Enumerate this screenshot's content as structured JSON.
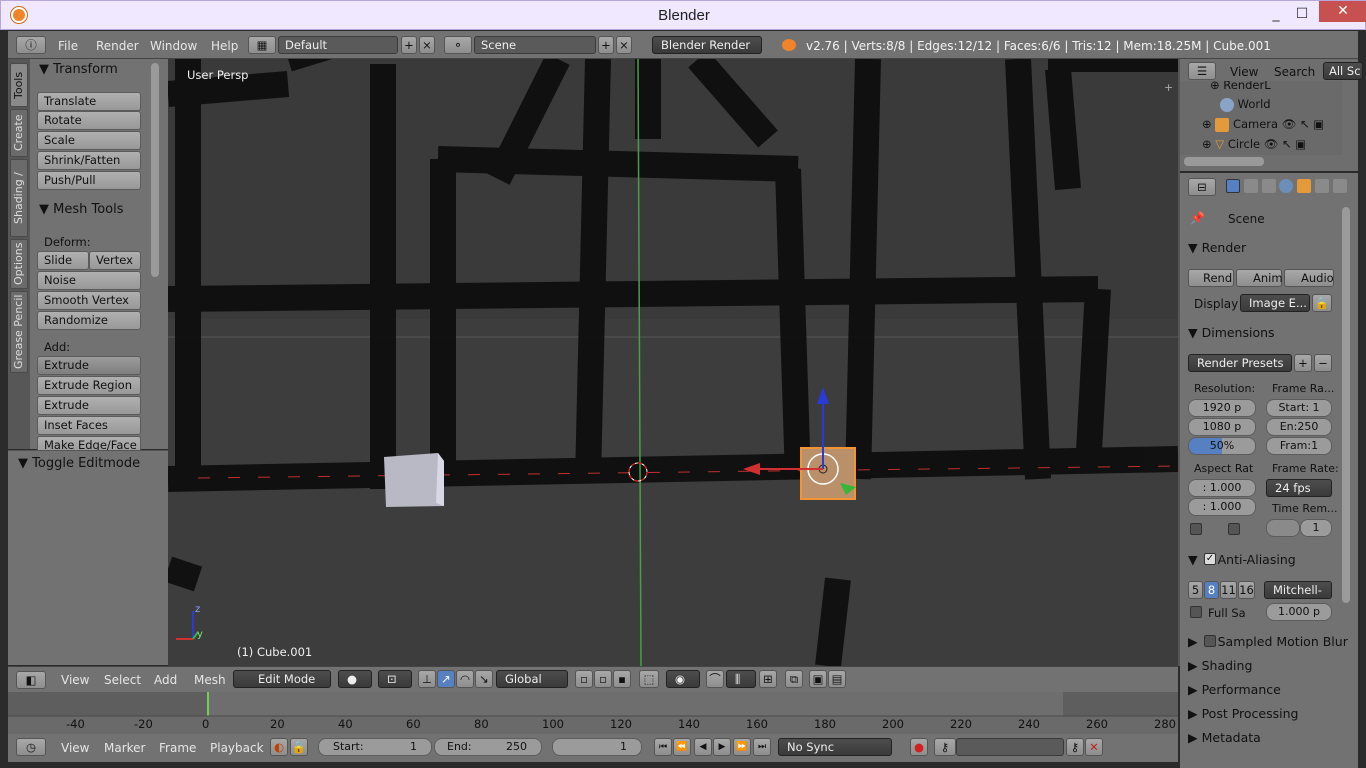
{
  "window": {
    "title": "Blender",
    "controls": [
      "_",
      "☐",
      "✕"
    ]
  },
  "info_header": {
    "menus": [
      "File",
      "Render",
      "Window",
      "Help"
    ],
    "screen": "Default",
    "scene": "Scene",
    "engine": "Blender Render",
    "stats": "v2.76 | Verts:8/8 | Edges:12/12 | Faces:6/6 | Tris:12 | Mem:18.25M | Cube.001"
  },
  "tool_tabs": [
    "Tools",
    "Create",
    "Shading / UVs",
    "Options",
    "Grease Pencil"
  ],
  "transform_panel": {
    "title": "Transform",
    "buttons": [
      "Translate",
      "Rotate",
      "Scale",
      "Shrink/Fatten",
      "Push/Pull"
    ]
  },
  "mesh_tools_panel": {
    "title": "Mesh Tools",
    "deform_label": "Deform:",
    "slide_edge": "Slide Ed",
    "vertex": "Vertex",
    "deform_buttons": [
      "Noise",
      "Smooth Vertex",
      "Randomize"
    ],
    "add_label": "Add:",
    "extrude": "Extrude",
    "add_buttons": [
      "Extrude Region",
      "Extrude Individual",
      "Inset Faces",
      "Make Edge/Face"
    ]
  },
  "toggle_editmode": "Toggle Editmode",
  "viewport": {
    "view_label": "User Persp",
    "object_label": "(1) Cube.001"
  },
  "view3d_header": {
    "menus": [
      "View",
      "Select",
      "Add",
      "Mesh"
    ],
    "mode": "Edit Mode",
    "orientation": "Global"
  },
  "timeline": {
    "ticks": [
      "-40",
      "-20",
      "0",
      "20",
      "40",
      "60",
      "80",
      "100",
      "120",
      "140",
      "160",
      "180",
      "200",
      "220",
      "240",
      "260",
      "280"
    ]
  },
  "timeline_header": {
    "menus": [
      "View",
      "Marker",
      "Frame",
      "Playback"
    ],
    "start_label": "Start:",
    "start_value": "1",
    "end_label": "End:",
    "end_value": "250",
    "current_frame": "1",
    "sync": "No Sync"
  },
  "outliner": {
    "menus": [
      "View",
      "Search"
    ],
    "filter": "All Sc",
    "items": [
      "RenderL",
      "World",
      "Camera",
      "Circle"
    ]
  },
  "properties": {
    "context": "Scene",
    "render": {
      "title": "Render",
      "buttons": [
        "Rend",
        "Anim",
        "Audio"
      ],
      "display_label": "Display",
      "display_value": "Image E..."
    },
    "dimensions": {
      "title": "Dimensions",
      "presets": "Render Presets",
      "resolution_label": "Resolution:",
      "res_x": "1920 p",
      "res_y": "1080 p",
      "res_pct": "50%",
      "frame_range_label": "Frame Ra...",
      "frame_start": "Start: 1",
      "frame_end": "En:250",
      "frame_step": "Fram:1",
      "aspect_label": "Aspect Rat",
      "aspect_x": ": 1.000",
      "aspect_y": ": 1.000",
      "frame_rate_label": "Frame Rate:",
      "fps": "24 fps",
      "time_remap_label": "Time Rem...",
      "time_remap_value": "1"
    },
    "anti_aliasing": {
      "title": "Anti-Aliasing",
      "samples": [
        "5",
        "8",
        "11",
        "16"
      ],
      "filter": "Mitchell-",
      "full_sample": "Full Sa",
      "size": "1.000 p"
    },
    "collapsed": [
      "Sampled Motion Blur",
      "Shading",
      "Performance",
      "Post Processing",
      "Metadata"
    ]
  },
  "colors": {
    "accent": "#5680c2",
    "selected_orange": "#f29431",
    "x_axis": "#d03030",
    "z_axis": "#2a3ad8",
    "y_axis": "#37b637"
  }
}
